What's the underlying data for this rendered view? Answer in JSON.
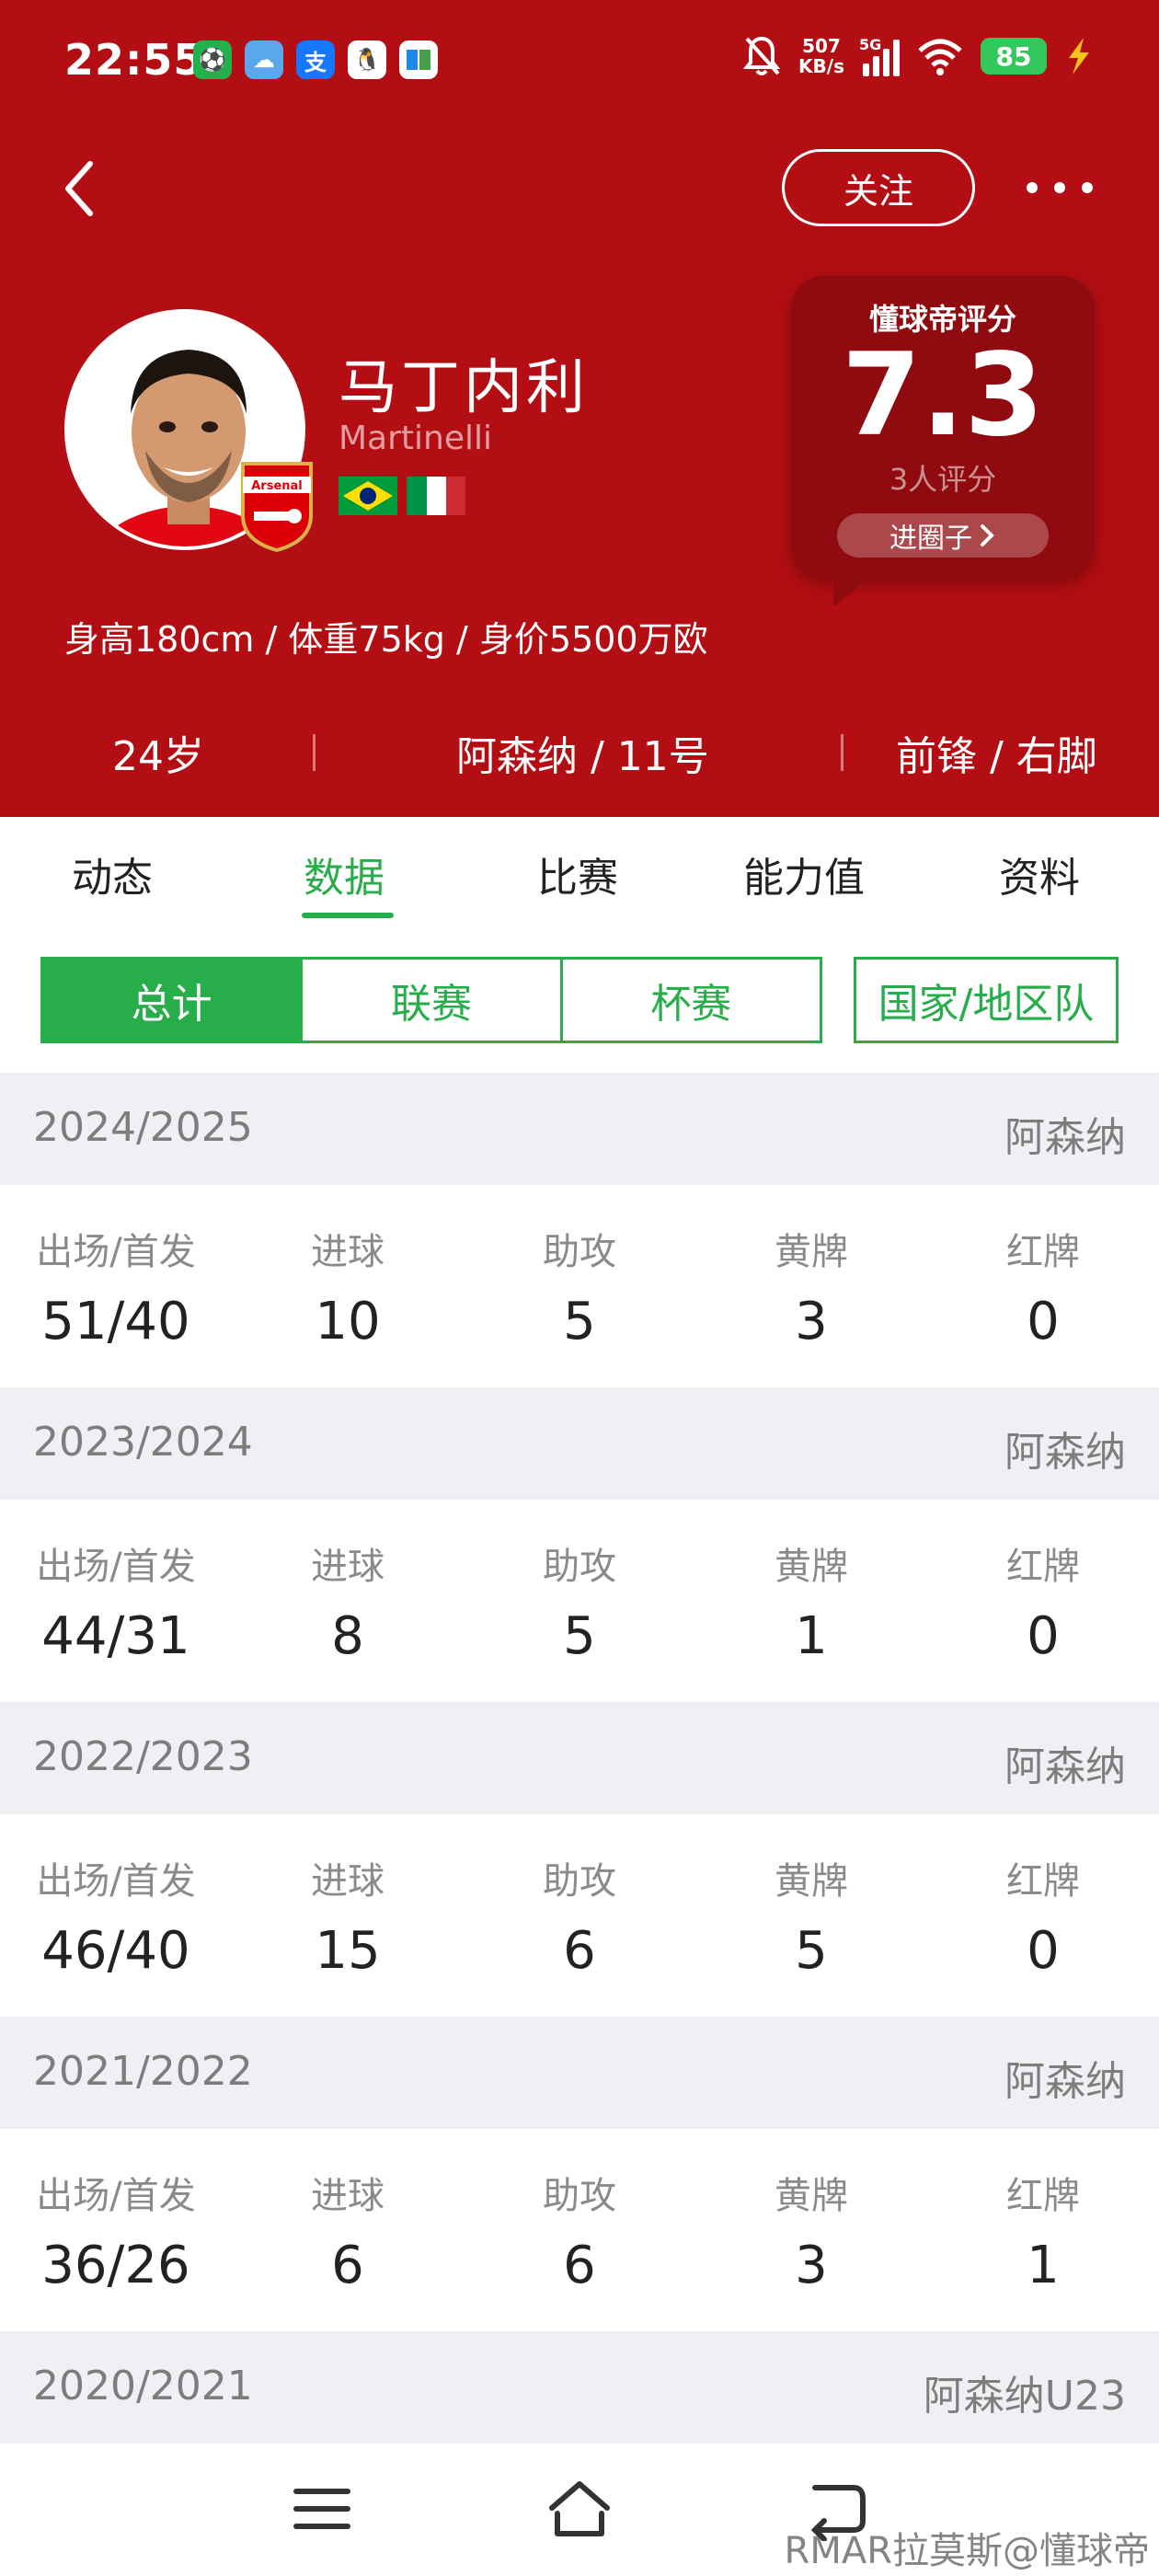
{
  "status_bar": {
    "time": "22:55",
    "net_speed_value": "507",
    "net_speed_unit": "KB/s",
    "signal_label": "5G",
    "battery": "85"
  },
  "header": {
    "follow_label": "关注",
    "player_name": "马丁内利",
    "player_name_en": "Martinelli",
    "rating_title": "懂球帝评分",
    "rating_score": "7.3",
    "rating_count": "3人评分",
    "circle_label": "进圈子",
    "measurements": "身高180cm / 体重75kg / 身价5500万欧",
    "age": "24岁",
    "club_number": "阿森纳 / 11号",
    "position_foot": "前锋 / 右脚",
    "badge_text": "Arsenal"
  },
  "tabs": [
    "动态",
    "数据",
    "比赛",
    "能力值",
    "资料"
  ],
  "active_tab": 1,
  "segments": [
    "总计",
    "联赛",
    "杯赛"
  ],
  "segment_national": "国家/地区队",
  "stat_labels": [
    "出场/首发",
    "进球",
    "助攻",
    "黄牌",
    "红牌"
  ],
  "seasons": [
    {
      "year": "2024/2025",
      "team": "阿森纳",
      "values": [
        "51/40",
        "10",
        "5",
        "3",
        "0"
      ]
    },
    {
      "year": "2023/2024",
      "team": "阿森纳",
      "values": [
        "44/31",
        "8",
        "5",
        "1",
        "0"
      ]
    },
    {
      "year": "2022/2023",
      "team": "阿森纳",
      "values": [
        "46/40",
        "15",
        "6",
        "5",
        "0"
      ]
    },
    {
      "year": "2021/2022",
      "team": "阿森纳",
      "values": [
        "36/26",
        "6",
        "6",
        "3",
        "1"
      ]
    },
    {
      "year": "2020/2021",
      "team": "阿森纳U23"
    }
  ],
  "watermark": "RMAR拉莫斯@懂球帝",
  "colors": {
    "header_red": "#b30e13",
    "accent_green": "#27ae4a",
    "rating_card": "#8f0b0f"
  }
}
